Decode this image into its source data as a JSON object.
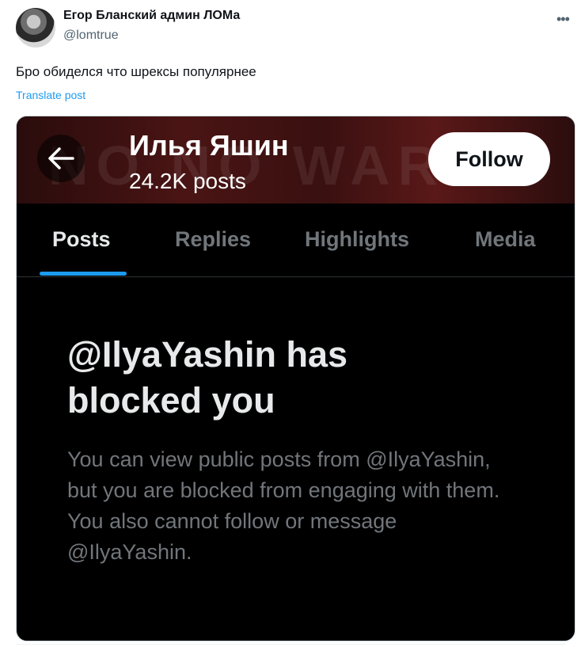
{
  "tweet": {
    "author_name": "Егор Бланский админ ЛОМа",
    "author_handle": "@lomtrue",
    "more_icon": "more-horizontal-icon",
    "text": "Бро обиделся что шрексы популярнее",
    "translate_label": "Translate post"
  },
  "embedded_screenshot": {
    "profile_name": "Илья Яшин",
    "posts_count": "24.2K posts",
    "back_icon": "arrow-left-icon",
    "follow_label": "Follow",
    "tabs": [
      {
        "label": "Posts",
        "active": true
      },
      {
        "label": "Replies",
        "active": false
      },
      {
        "label": "Highlights",
        "active": false
      },
      {
        "label": "Media",
        "active": false
      }
    ],
    "blocked_title": "@IlyaYashin has blocked you",
    "blocked_description": "You can view public posts from @IlyaYashin, but you are blocked from engaging with them. You also cannot follow or message @IlyaYashin.",
    "banner_watermark": "NO NO WAR"
  },
  "colors": {
    "accent": "#1d9bf0",
    "text_primary": "#0f1419",
    "text_secondary": "#536471",
    "dark_bg": "#000000"
  }
}
